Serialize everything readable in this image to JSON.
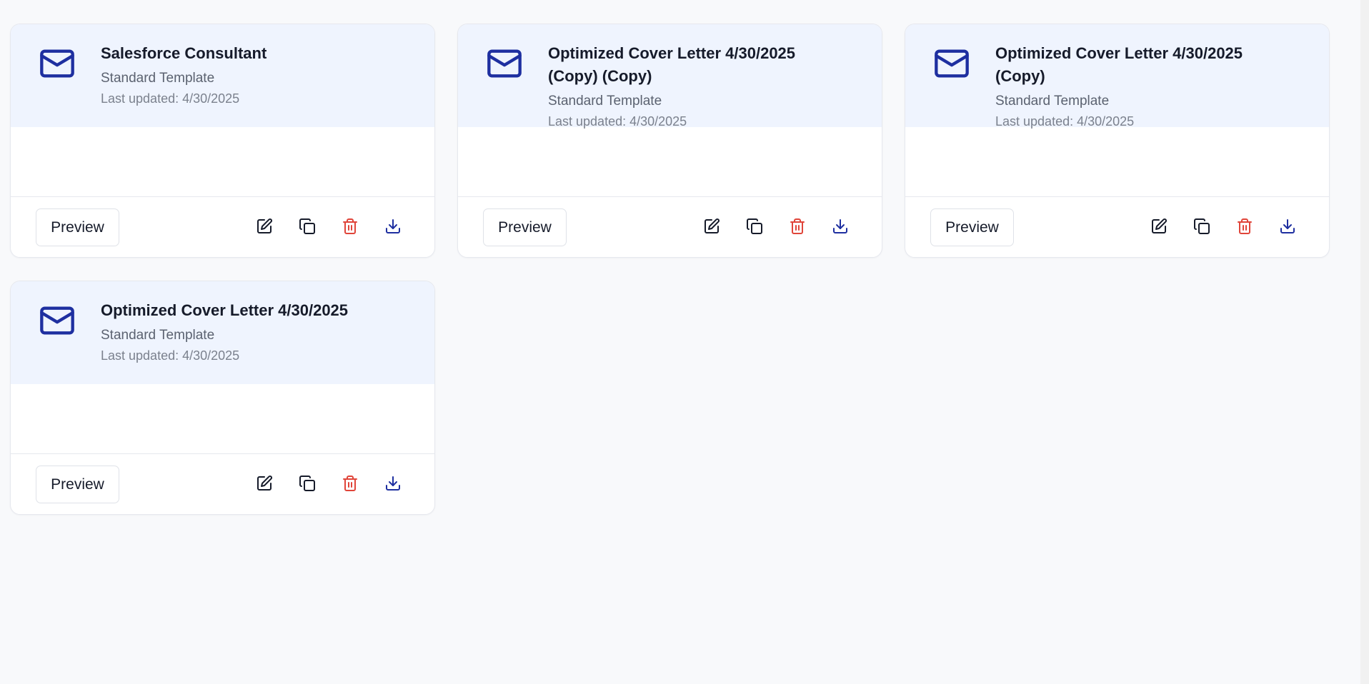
{
  "colors": {
    "accent": "#1e2fa0",
    "danger": "#e0453a",
    "header_bg": "#eff4fe",
    "page_bg": "#f8f9fb"
  },
  "cards": [
    {
      "icon": "mail-icon",
      "title": "Salesforce Consultant",
      "template": "Standard Template",
      "updated": "Last updated: 4/30/2025",
      "preview_label": "Preview"
    },
    {
      "icon": "mail-icon",
      "title": "Optimized Cover Letter 4/30/2025 (Copy) (Copy)",
      "template": "Standard Template",
      "updated": "Last updated: 4/30/2025",
      "preview_label": "Preview"
    },
    {
      "icon": "mail-icon",
      "title": "Optimized Cover Letter 4/30/2025 (Copy)",
      "template": "Standard Template",
      "updated": "Last updated: 4/30/2025",
      "preview_label": "Preview"
    },
    {
      "icon": "mail-icon",
      "title": "Optimized Cover Letter 4/30/2025",
      "template": "Standard Template",
      "updated": "Last updated: 4/30/2025",
      "preview_label": "Preview"
    }
  ],
  "card_actions": [
    "edit-icon",
    "copy-icon",
    "trash-icon",
    "download-icon"
  ]
}
